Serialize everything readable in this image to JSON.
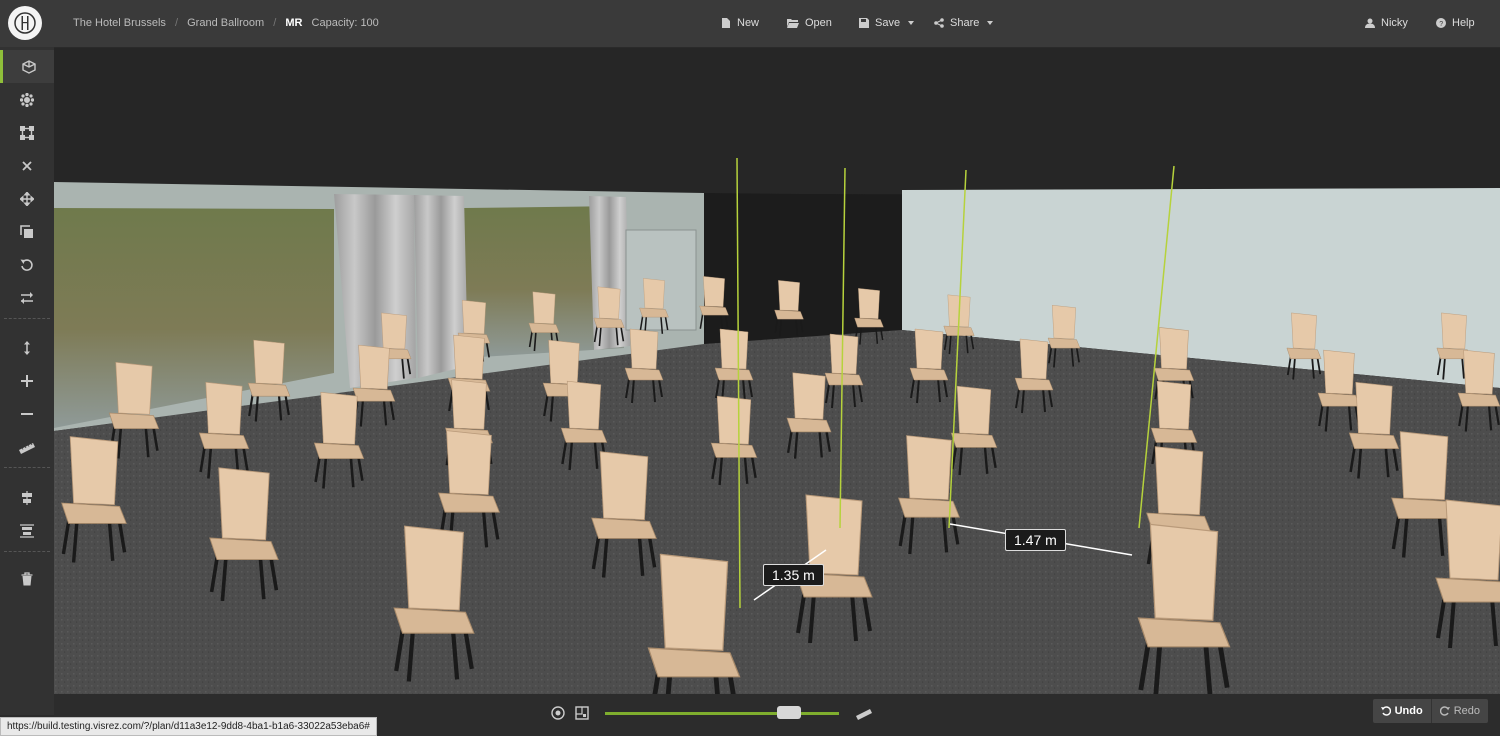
{
  "header": {
    "breadcrumbs": [
      "The Hotel Brussels",
      "Grand Ballroom",
      "MR"
    ],
    "capacity": "Capacity: 100",
    "actions": {
      "new": "New",
      "open": "Open",
      "save": "Save",
      "share": "Share"
    },
    "user": "Nicky",
    "help": "Help"
  },
  "sidebar": {
    "tools": [
      "3d-view-icon",
      "layout-icon",
      "select-area-icon",
      "close-icon",
      "move-icon",
      "copy-icon",
      "rotate-icon",
      "swap-icon",
      "height-icon",
      "plus-icon",
      "minus-icon",
      "ruler-icon",
      "align-center-icon",
      "distribute-icon",
      "trash-icon"
    ]
  },
  "viewport": {
    "measurements": [
      "1.35 m",
      "1.47 m"
    ]
  },
  "bottom": {
    "zoom_level": 0.78,
    "undo": "Undo",
    "redo": "Redo",
    "status_url": "https://build.testing.visrez.com/?/plan/d11a3e12-9dd8-4ba1-b1a6-33022a53eba6#"
  }
}
